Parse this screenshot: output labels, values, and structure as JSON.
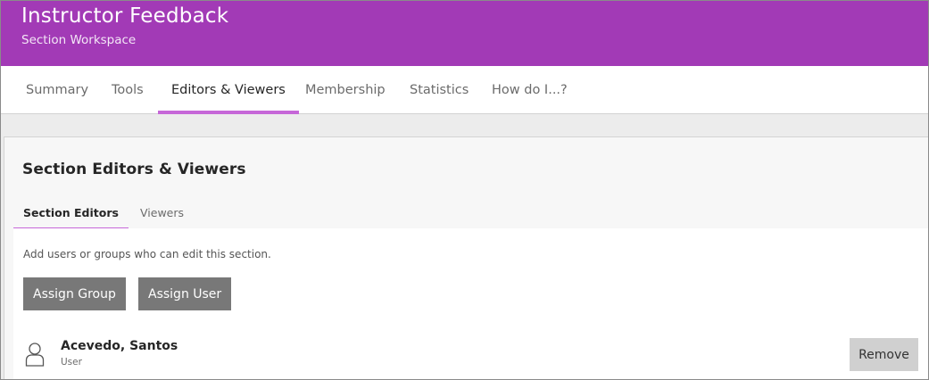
{
  "header": {
    "title": "Instructor Feedback",
    "subtitle": "Section Workspace",
    "color": "#a23ab6"
  },
  "tabs": [
    {
      "label": "Summary",
      "active": false
    },
    {
      "label": "Tools",
      "active": false
    },
    {
      "label": "Editors & Viewers",
      "active": true
    },
    {
      "label": "Membership",
      "active": false
    },
    {
      "label": "Statistics",
      "active": false
    },
    {
      "label": "How do I...?",
      "active": false
    }
  ],
  "panel": {
    "title": "Section Editors & Viewers",
    "subtabs": [
      {
        "label": "Section Editors",
        "active": true
      },
      {
        "label": "Viewers",
        "active": false
      }
    ],
    "hint": "Add users or groups who can edit this section.",
    "buttons": {
      "assign_group": "Assign Group",
      "assign_user": "Assign User"
    },
    "users": [
      {
        "name": "Acevedo, Santos",
        "role": "User",
        "icon": "user-icon",
        "action": "Remove"
      }
    ]
  },
  "accent": "#c667d8"
}
